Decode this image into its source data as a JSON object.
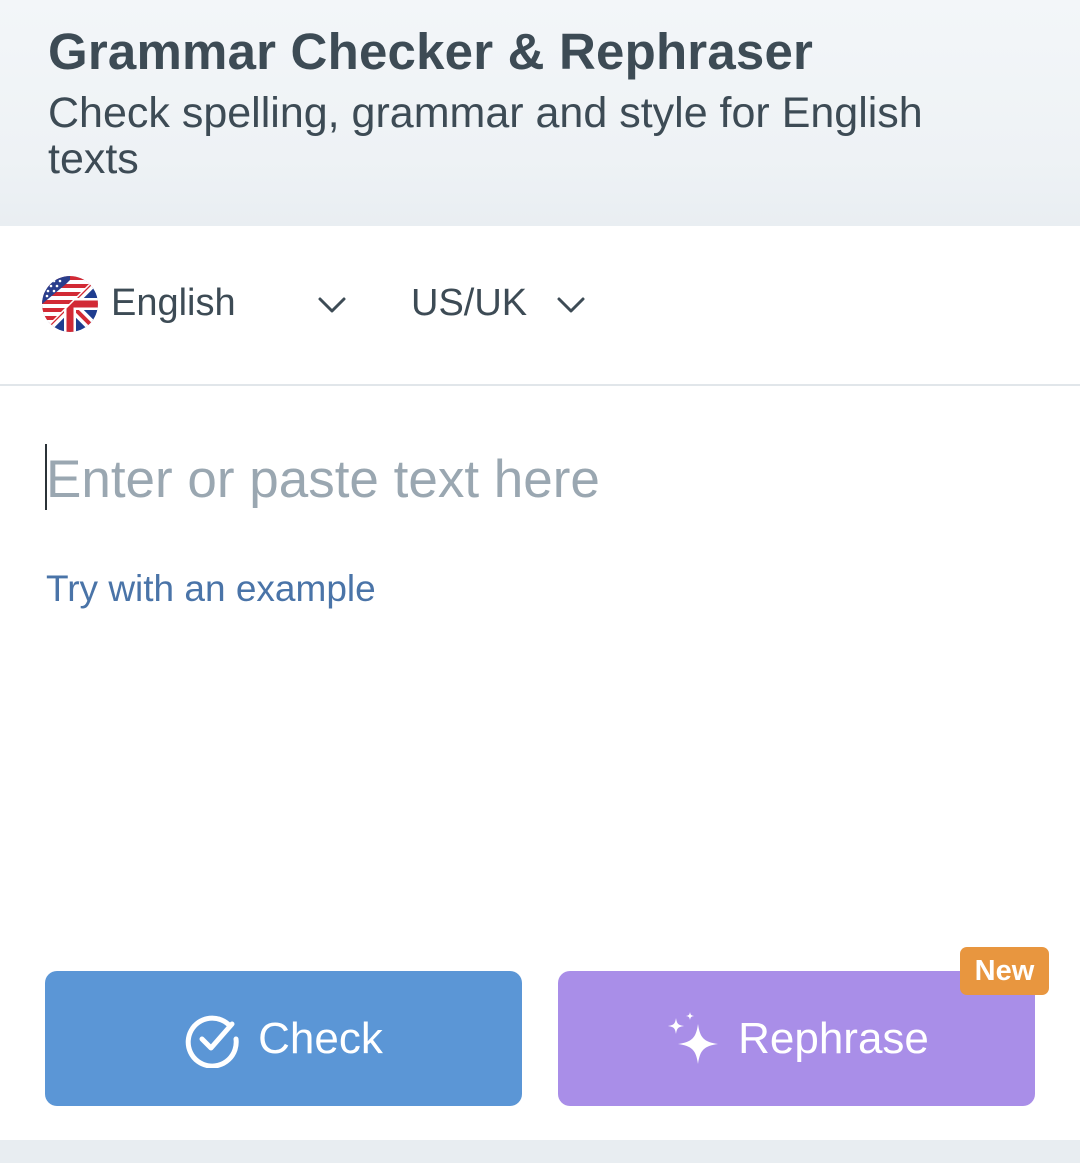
{
  "header": {
    "title": "Grammar Checker & Rephraser",
    "subtitle": "Check spelling, grammar and style for English texts"
  },
  "language_bar": {
    "language": "English",
    "language_icon": "us-uk-flag-icon",
    "variant": "US/UK"
  },
  "editor": {
    "value": "",
    "placeholder": "Enter or paste text here",
    "example_link": "Try with an example"
  },
  "actions": {
    "check_label": "Check",
    "check_icon": "check-circle-icon",
    "rephrase_label": "Rephrase",
    "rephrase_icon": "sparkles-icon",
    "rephrase_badge": "New"
  },
  "colors": {
    "check_button": "#5b96d6",
    "rephrase_button": "#a98ee8",
    "badge": "#e8963f",
    "link": "#4a74a8",
    "text": "#3d4b55"
  }
}
